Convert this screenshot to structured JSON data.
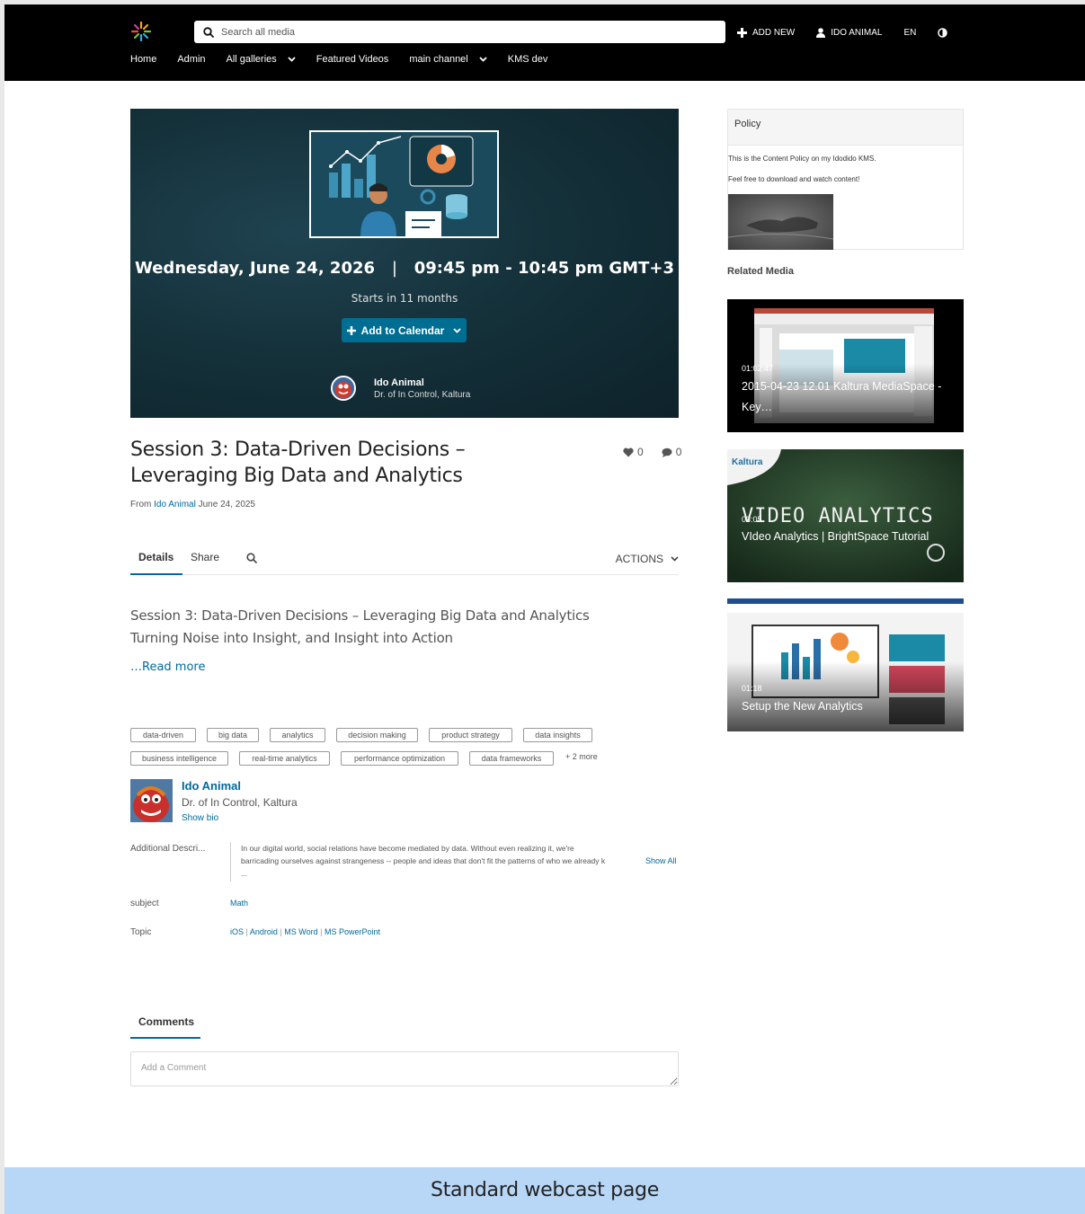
{
  "header": {
    "search_placeholder": "Search all media",
    "add_new": "ADD NEW",
    "user": "IDO ANIMAL",
    "lang": "EN"
  },
  "nav": {
    "items": [
      {
        "label": "Home"
      },
      {
        "label": "Admin"
      },
      {
        "label": "All galleries",
        "dropdown": true
      },
      {
        "label": "Featured Videos"
      },
      {
        "label": "main channel",
        "dropdown": true
      },
      {
        "label": "KMS dev"
      }
    ]
  },
  "event": {
    "date": "Wednesday, June 24, 2026",
    "separator": "|",
    "time": "09:45 pm - 10:45 pm GMT+3",
    "starts": "Starts in 11 months",
    "add_to_calendar": "Add to Calendar",
    "presenter_name": "Ido Animal",
    "presenter_role": "Dr. of In Control, Kaltura"
  },
  "media": {
    "title": "Session 3: Data-Driven Decisions – Leveraging Big Data and Analytics",
    "likes": "0",
    "comments_count": "0",
    "from_label": "From",
    "owner_link": "Ido Animal",
    "date": "June 24, 2025"
  },
  "tabs": {
    "details": "Details",
    "share": "Share",
    "actions": "ACTIONS"
  },
  "description": {
    "line1": "Session 3: Data-Driven Decisions – Leveraging Big Data and Analytics",
    "line2": "Turning Noise into Insight, and Insight into Action",
    "read_more": "…Read more"
  },
  "tags": {
    "row1": [
      "data-driven",
      "big data",
      "analytics",
      "decision making",
      "product strategy",
      "data insights"
    ],
    "row2": [
      "business intelligence",
      "real-time analytics",
      "performance optimization",
      "data frameworks"
    ],
    "more": "+ 2 more"
  },
  "owner": {
    "name": "Ido Animal",
    "role": "Dr. of In Control, Kaltura",
    "show_bio": "Show bio"
  },
  "metadata": {
    "additional_label": "Additional Descri...",
    "additional_line1": "In our digital world, social relations have become mediated by data. Without even realizing it, we're",
    "additional_line2": "barricading ourselves against strangeness -- people and ideas that don't fit the patterns of who we already k",
    "additional_line3": "...",
    "show_all": "Show All",
    "subject_label": "subject",
    "subject_value": "Math",
    "topic_label": "Topic",
    "topics": [
      "iOS",
      "Android",
      "MS Word",
      "MS PowerPoint"
    ],
    "topic_sep": "|"
  },
  "comments": {
    "tab": "Comments",
    "placeholder": "Add a Comment"
  },
  "sidebar": {
    "policy_title": "Policy",
    "policy_line1": "This is the Content Policy on my Idodido KMS.",
    "policy_line2": "Feel free to download and watch content!",
    "related_title": "Related Media",
    "related": [
      {
        "duration": "01:02:47",
        "title": "2015-04-23 12.01 Kaltura MediaSpace - Key…"
      },
      {
        "duration": "03:05",
        "title": "VIdeo Analytics | BrightSpace Tutorial"
      },
      {
        "duration": "01:18",
        "title": "Setup the New Analytics"
      }
    ],
    "thumb2_brand": "Kaltura",
    "thumb2_heading": "VIDEO ANALYTICS"
  },
  "caption": "Standard webcast page"
}
